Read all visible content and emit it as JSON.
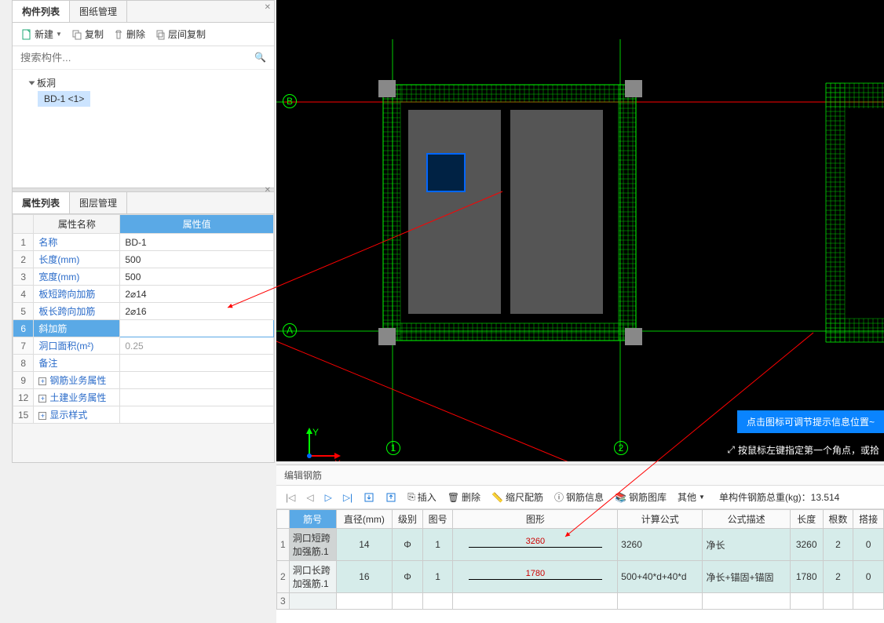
{
  "leftPanel": {
    "tabs": [
      "构件列表",
      "图纸管理"
    ],
    "toolbar": {
      "new": "新建",
      "copy": "复制",
      "delete": "删除",
      "layerCopy": "层间复制"
    },
    "searchPlaceholder": "搜索构件...",
    "tree": {
      "root": "板洞",
      "child": "BD-1 <1>"
    }
  },
  "propPanel": {
    "tabs": [
      "属性列表",
      "图层管理"
    ],
    "headers": {
      "name": "属性名称",
      "value": "属性值"
    },
    "rows": [
      {
        "n": "1",
        "name": "名称",
        "val": "BD-1"
      },
      {
        "n": "2",
        "name": "长度(mm)",
        "val": "500"
      },
      {
        "n": "3",
        "name": "宽度(mm)",
        "val": "500"
      },
      {
        "n": "4",
        "name": "板短跨向加筋",
        "val": "2⌀14"
      },
      {
        "n": "5",
        "name": "板长跨向加筋",
        "val": "2⌀16"
      },
      {
        "n": "6",
        "name": "斜加筋",
        "val": "",
        "sel": true
      },
      {
        "n": "7",
        "name": "洞口面积(m²)",
        "val": "0.25",
        "gray": true
      },
      {
        "n": "8",
        "name": "备注",
        "val": ""
      },
      {
        "n": "9",
        "name": "钢筋业务属性",
        "val": "",
        "exp": true
      },
      {
        "n": "12",
        "name": "土建业务属性",
        "val": "",
        "exp": true
      },
      {
        "n": "15",
        "name": "显示样式",
        "val": "",
        "exp": true
      }
    ]
  },
  "canvas": {
    "gridA": "A",
    "gridB": "B",
    "grid1": "1",
    "grid2": "2",
    "hint": "点击图标可调节提示信息位置~",
    "status": "按鼠标左键指定第一个角点，或拾"
  },
  "rebar": {
    "title": "编辑钢筋",
    "btns": {
      "insert": "插入",
      "delete": "删除",
      "scale": "缩尺配筋",
      "info": "钢筋信息",
      "lib": "钢筋图库",
      "other": "其他"
    },
    "weight": {
      "label": "单构件钢筋总重(kg)：",
      "val": "13.514"
    },
    "headers": [
      "筋号",
      "直径(mm)",
      "级别",
      "图号",
      "图形",
      "计算公式",
      "公式描述",
      "长度",
      "根数",
      "搭接"
    ],
    "rows": [
      {
        "n": "1",
        "name": "洞口短跨加强筋.1",
        "dia": "14",
        "lvl": "Φ",
        "fig": "1",
        "shape": "3260",
        "formula": "3260",
        "desc": "净长",
        "len": "3260",
        "cnt": "2",
        "lap": "0",
        "sel": true
      },
      {
        "n": "2",
        "name": "洞口长跨加强筋.1",
        "dia": "16",
        "lvl": "Φ",
        "fig": "1",
        "shape": "1780",
        "formula": "500+40*d+40*d",
        "desc": "净长+锚固+锚固",
        "len": "1780",
        "cnt": "2",
        "lap": "0"
      },
      {
        "n": "3",
        "name": "",
        "dia": "",
        "lvl": "",
        "fig": "",
        "shape": "",
        "formula": "",
        "desc": "",
        "len": "",
        "cnt": "",
        "lap": "",
        "empty": true
      }
    ]
  }
}
